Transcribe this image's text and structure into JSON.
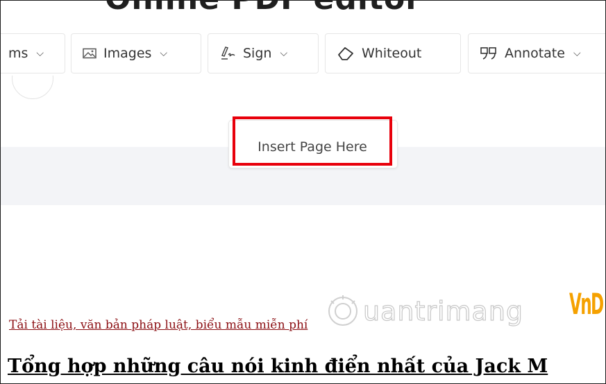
{
  "app": {
    "title": "Online PDF editor"
  },
  "toolbar": {
    "items": [
      {
        "label": "ms",
        "icon": "forms-icon"
      },
      {
        "label": "Images",
        "icon": "image-icon"
      },
      {
        "label": "Sign",
        "icon": "signature-icon"
      },
      {
        "label": "Whiteout",
        "icon": "eraser-icon"
      },
      {
        "label": "Annotate",
        "icon": "quote-icon"
      }
    ]
  },
  "insert_page": {
    "label": "Insert Page Here",
    "highlight_color": "#e8000b"
  },
  "document": {
    "link_text": "Tải tài liệu, văn bản pháp luật, biểu mẫu miễn phí",
    "heading": "Tổng hợp những câu nói kinh điển nhất của Jack M"
  },
  "watermark": {
    "text": "uantrimang",
    "logo": "VnD"
  }
}
